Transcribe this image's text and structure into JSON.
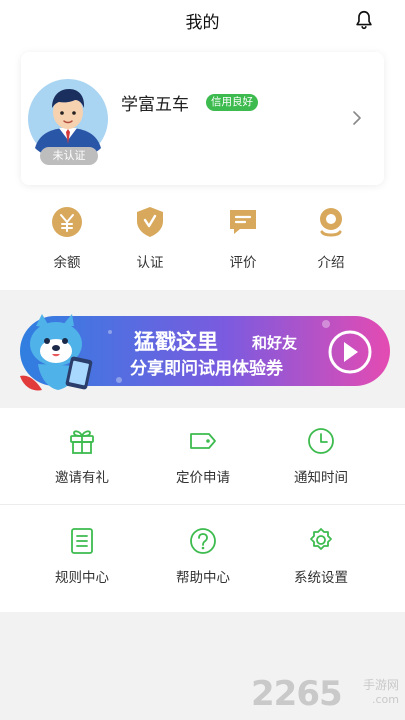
{
  "header": {
    "title": "我的"
  },
  "profile": {
    "username": "学富五车",
    "credit_badge": "信用良好",
    "verify_status": "未认证"
  },
  "quick_actions": [
    {
      "label": "余额",
      "icon": "yen-icon"
    },
    {
      "label": "认证",
      "icon": "shield-icon"
    },
    {
      "label": "评价",
      "icon": "comment-icon"
    },
    {
      "label": "介绍",
      "icon": "location-icon"
    }
  ],
  "banner": {
    "line1": "猛戳这里",
    "line1_small": "和好友",
    "line2": "分享即问试用体验券"
  },
  "menu": [
    {
      "label": "邀请有礼",
      "icon": "gift-icon"
    },
    {
      "label": "定价申请",
      "icon": "price-tag-icon"
    },
    {
      "label": "通知时间",
      "icon": "clock-icon"
    },
    {
      "label": "规则中心",
      "icon": "document-icon"
    },
    {
      "label": "帮助中心",
      "icon": "help-icon"
    },
    {
      "label": "系统设置",
      "icon": "gear-icon"
    }
  ],
  "watermark": {
    "number": "2265",
    "cn": "手游网",
    "domain": ".com"
  },
  "colors": {
    "accent": "#3dbb4e",
    "gold": "#d8a95c",
    "banner_start": "#2f7fe0",
    "banner_end": "#e44bb2"
  }
}
